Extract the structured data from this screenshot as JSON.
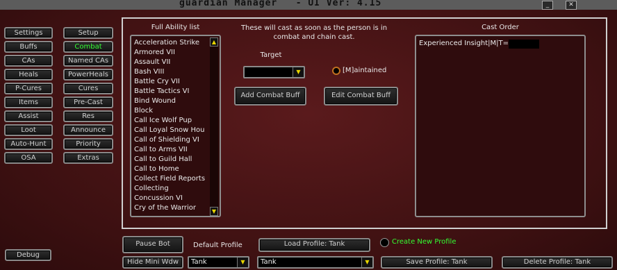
{
  "window": {
    "title": "guardian Manager   - UI Ver: 4.15",
    "minimize_label": "_",
    "close_label": "✕"
  },
  "nav": {
    "left": [
      "Settings",
      "Buffs",
      "CAs",
      "Heals",
      "P-Cures",
      "Items",
      "Assist",
      "Loot",
      "Auto-Hunt",
      "OSA"
    ],
    "right": [
      "Setup",
      "Combat",
      "Named CAs",
      "PowerHeals",
      "Cures",
      "Pre-Cast",
      "Res",
      "Announce",
      "Priority",
      "Extras"
    ],
    "active": "Combat",
    "debug_label": "Debug"
  },
  "ability_list": {
    "title": "Full Ability list",
    "items": [
      "Acceleration Strike",
      "Armored VII",
      "Assault VII",
      "Bash VIII",
      "Battle Cry VII",
      "Battle Tactics VI",
      "Bind Wound",
      "Block",
      "Call Ice Wolf Pup",
      "Call Loyal Snow Hou",
      "Call of Shielding VI",
      "Call to Arms VII",
      "Call to Guild Hall",
      "Call to Home",
      "Collect Field Reports",
      "Collecting",
      "Concussion VI",
      "Cry of the Warrior"
    ],
    "scroll_up": "▲",
    "scroll_down": "▼"
  },
  "combat": {
    "description_line1": "These will cast as soon as the person is in",
    "description_line2": "combat and chain cast.",
    "target_label": "Target",
    "target_value": "",
    "maintained_label": "[M]aintained",
    "add_button": "Add Combat Buff",
    "edit_button": "Edit Combat Buff"
  },
  "cast_order": {
    "title": "Cast Order",
    "entries": [
      "Experienced Insight|M|T="
    ]
  },
  "bottom": {
    "pause_bot": "Pause Bot",
    "hide_mini": "Hide Mini Wdw",
    "default_profile_label": "Default Profile",
    "default_profile_value": "Tank",
    "load_profile": "Load Profile: Tank",
    "profile_value": "Tank",
    "create_new_profile": "Create New Profile",
    "save_profile": "Save Profile: Tank",
    "delete_profile": "Delete Profile: Tank"
  },
  "colors": {
    "background": "#3a0f10",
    "active_text": "#33ff33",
    "arrow": "#e8d600"
  }
}
